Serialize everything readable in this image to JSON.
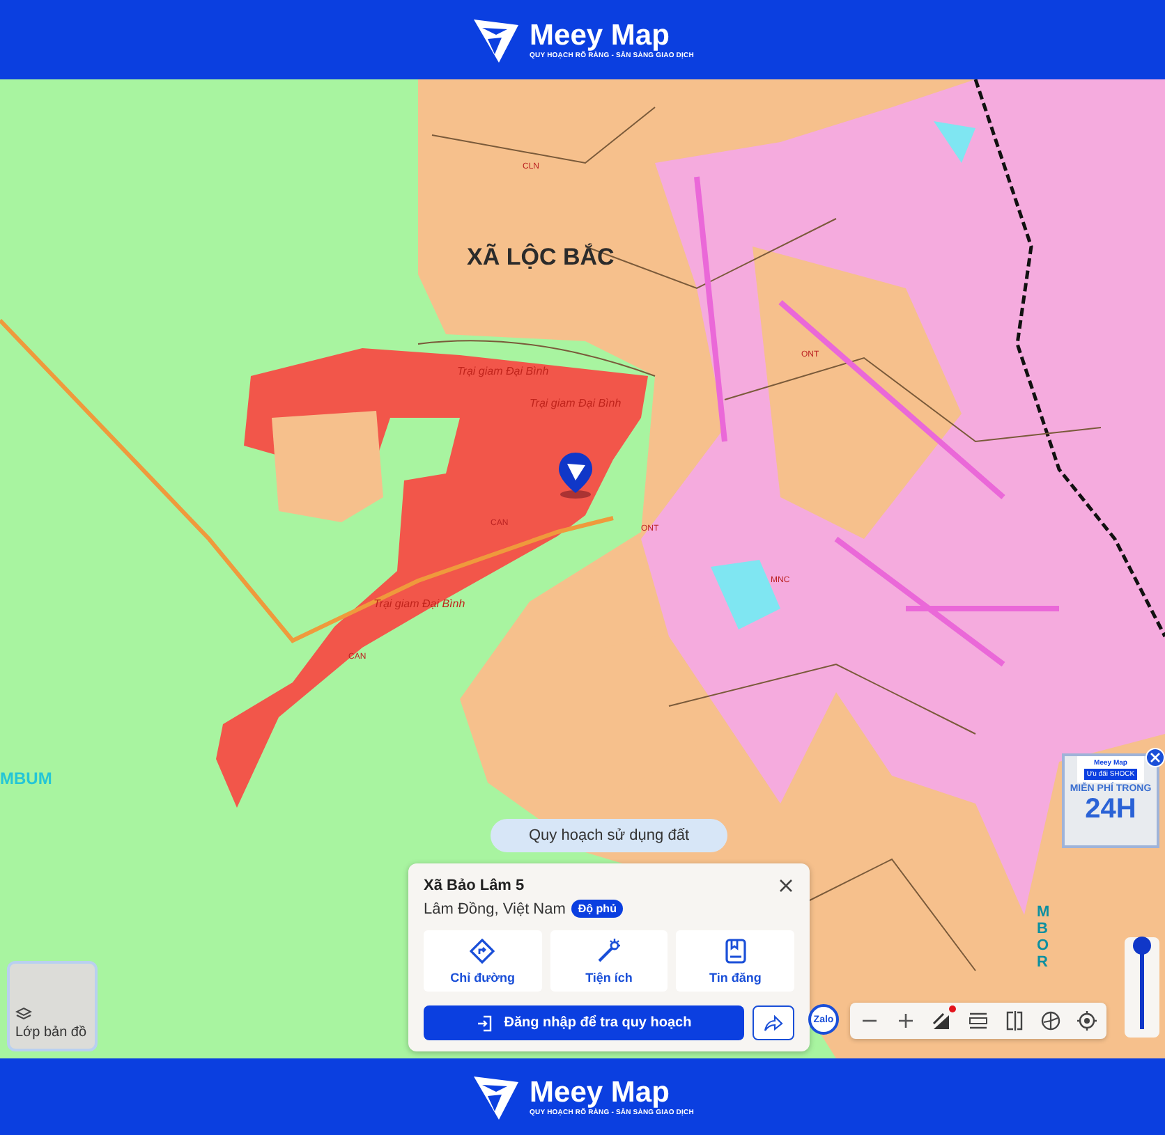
{
  "header": {
    "brand": "Meey Map",
    "tagline": "QUY HOẠCH RÕ RÀNG - SẴN SÀNG GIAO DỊCH"
  },
  "map": {
    "labels": [
      {
        "text": "XÃ LỘC BẮC",
        "kind": "commune"
      },
      {
        "text": "Trại giam Đại Bình",
        "kind": "area"
      },
      {
        "text": "Trại giam Đại Bình",
        "kind": "area"
      },
      {
        "text": "Trại giam Đại Bình",
        "kind": "area"
      },
      {
        "text": "CAN",
        "kind": "code"
      },
      {
        "text": "CAN",
        "kind": "code"
      },
      {
        "text": "CLN",
        "kind": "code"
      },
      {
        "text": "ONT",
        "kind": "code"
      },
      {
        "text": "ONT",
        "kind": "code"
      },
      {
        "text": "MNC",
        "kind": "code"
      },
      {
        "text": "MBUM",
        "kind": "river"
      },
      {
        "text": "MBOR",
        "kind": "river-vertical"
      }
    ]
  },
  "layer_chip": "Quy hoạch sử dụng đất",
  "place_card": {
    "title": "Xã Bảo Lâm 5",
    "subtitle": "Lâm Đồng, Việt Nam",
    "badge": "Độ phủ",
    "actions": [
      {
        "label": "Chỉ đường",
        "kind": "directions"
      },
      {
        "label": "Tiện ích",
        "kind": "utilities"
      },
      {
        "label": "Tin đăng",
        "kind": "listings"
      }
    ],
    "login_button": "Đăng nhập để tra quy hoạch"
  },
  "layer_button": "Lớp bản đồ",
  "promo": {
    "brand": "Meey Map",
    "badge": "Ưu đãi SHOCK",
    "line1": "MIỄN PHÍ TRONG",
    "line2": "24H"
  },
  "zalo": "Zalo",
  "toolbar": {
    "tools": [
      {
        "kind": "minus"
      },
      {
        "kind": "plus"
      },
      {
        "kind": "draw",
        "alert": true
      },
      {
        "kind": "ruler"
      },
      {
        "kind": "split"
      },
      {
        "kind": "globe"
      },
      {
        "kind": "locate"
      }
    ]
  },
  "opacity_slider": {
    "level": 1
  },
  "footer": {
    "brand": "Meey Map",
    "tagline": "QUY HOẠCH RÕ RÀNG - SẴN SÀNG GIAO DỊCH"
  }
}
